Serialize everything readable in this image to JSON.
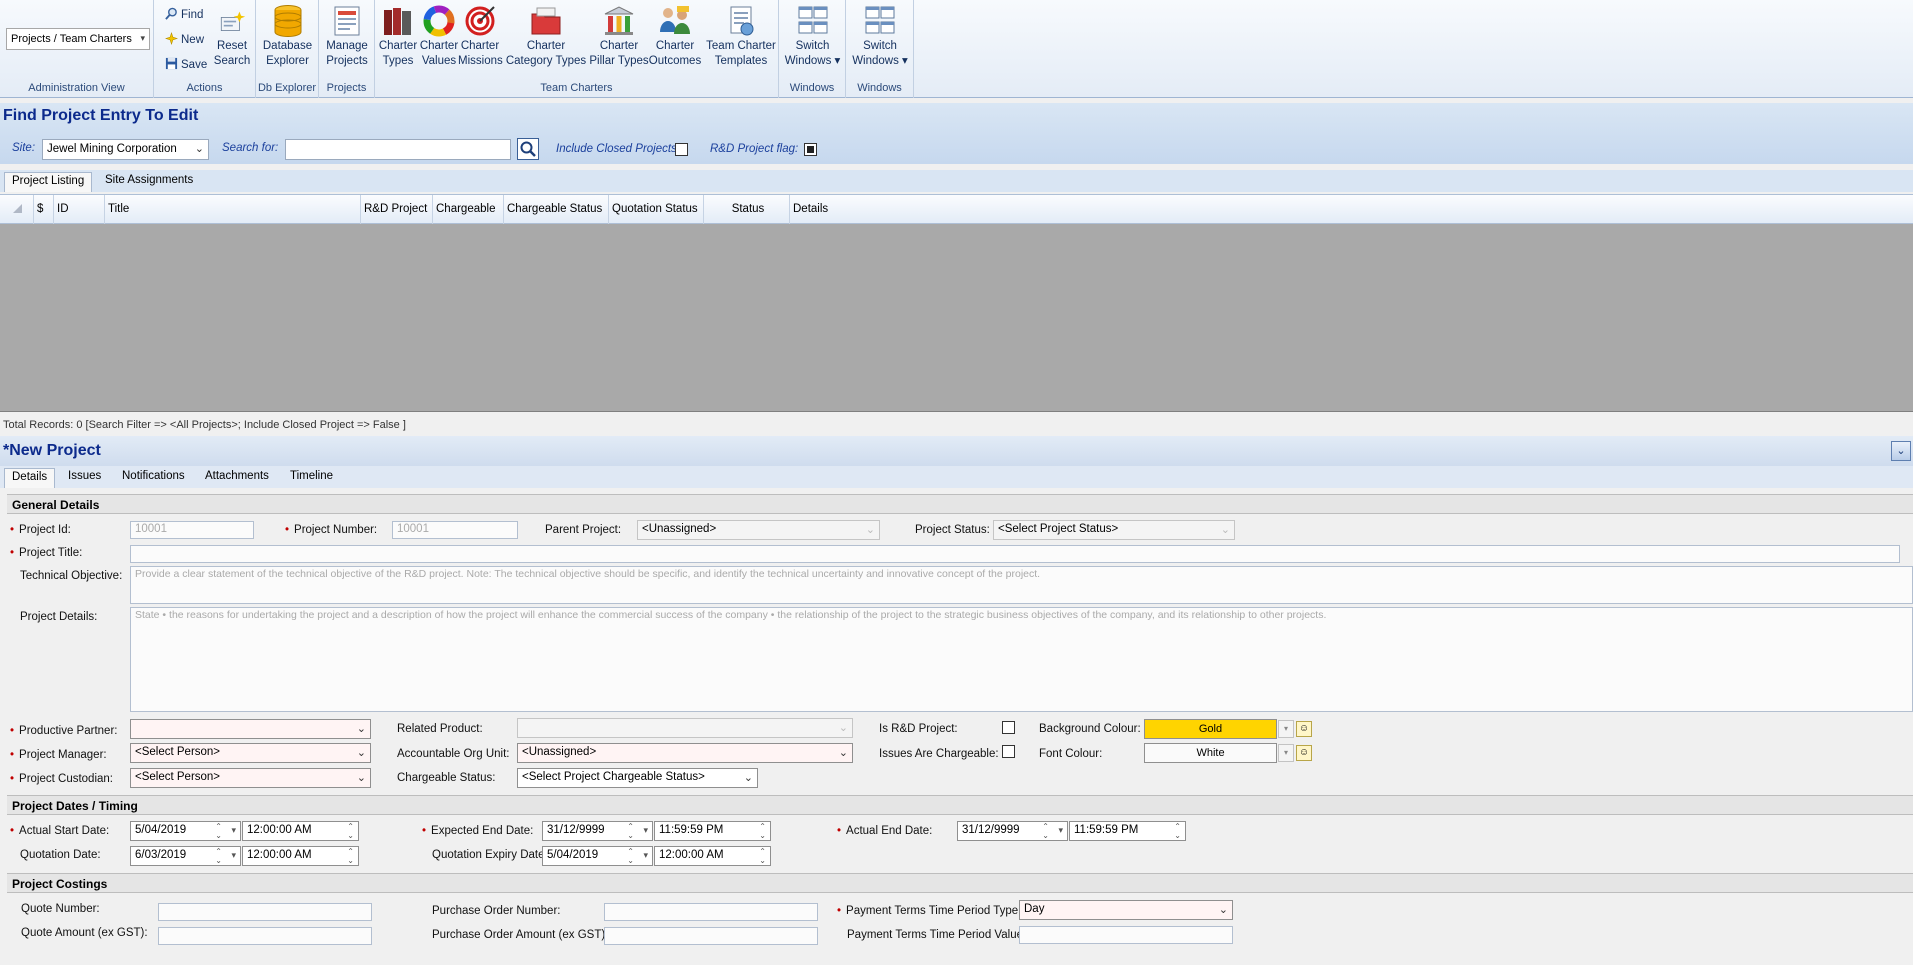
{
  "ribbon": {
    "view_selector": "Projects / Team Charters",
    "groups": {
      "admin": "Administration View",
      "actions": "Actions",
      "db": "Db Explorer",
      "projects": "Projects",
      "team_charters": "Team Charters",
      "windows1": "Windows",
      "windows2": "Windows"
    },
    "actions": {
      "find": "Find",
      "new": "New",
      "save": "Save",
      "reset_l1": "Reset",
      "reset_l2": "Search"
    },
    "db_explorer": {
      "l1": "Database",
      "l2": "Explorer"
    },
    "manage_projects": {
      "l1": "Manage",
      "l2": "Projects"
    },
    "charter_buttons": [
      {
        "l1": "Charter",
        "l2": "Types"
      },
      {
        "l1": "Charter",
        "l2": "Values"
      },
      {
        "l1": "Charter",
        "l2": "Missions"
      },
      {
        "l1": "Charter",
        "l2": "Category Types"
      },
      {
        "l1": "Charter",
        "l2": "Pillar Types"
      },
      {
        "l1": "Charter",
        "l2": "Outcomes"
      },
      {
        "l1": "Team Charter",
        "l2": "Templates"
      }
    ],
    "switch1": {
      "l1": "Switch",
      "l2": "Windows ▾"
    },
    "switch2": {
      "l1": "Switch",
      "l2": "Windows ▾"
    }
  },
  "find": {
    "title": "Find Project Entry To Edit",
    "site_label": "Site:",
    "site_value": "Jewel Mining Corporation",
    "search_label": "Search for:",
    "search_value": "",
    "include_closed_label": "Include Closed Projects:",
    "rd_flag_label": "R&D Project flag:"
  },
  "list_tabs": [
    "Project Listing",
    "Site Assignments"
  ],
  "grid": {
    "columns": [
      "$",
      "ID",
      "Title",
      "R&D Project",
      "Chargeable",
      "Chargeable Status",
      "Quotation Status",
      "Status",
      "Details"
    ]
  },
  "status_text": "Total Records: 0 [Search Filter => <All Projects>; Include Closed Project => False ]",
  "project": {
    "title": "*New Project",
    "tabs": [
      "Details",
      "Issues",
      "Notifications",
      "Attachments",
      "Timeline"
    ],
    "sections": {
      "general": "General Details",
      "dates": "Project Dates / Timing",
      "costings": "Project Costings"
    },
    "general": {
      "project_id_label": "Project Id:",
      "project_id_value": "10001",
      "project_number_label": "Project Number:",
      "project_number_value": "10001",
      "parent_project_label": "Parent Project:",
      "parent_project_value": "<Unassigned>",
      "project_status_label": "Project Status:",
      "project_status_value": "<Select Project Status>",
      "project_title_label": "Project Title:",
      "project_title_value": "",
      "tech_objective_label": "Technical Objective:",
      "tech_objective_placeholder": "Provide a clear statement of the technical objective of the R&D project.  Note:  The technical objective should be specific, and identify the technical uncertainty and innovative concept of the project.",
      "project_details_label": "Project Details:",
      "project_details_placeholder": "State    • the reasons for undertaking the project and a description of how the project will enhance the commercial success of the company   •  the relationship of the project to the strategic business objectives of the company, and its relationship to other projects.",
      "productive_partner_label": "Productive Partner:",
      "productive_partner_value": "",
      "project_manager_label": "Project Manager:",
      "project_manager_value": "<Select Person>",
      "project_custodian_label": "Project Custodian:",
      "project_custodian_value": "<Select Person>",
      "related_product_label": "Related Product:",
      "related_product_value": "",
      "accountable_org_label": "Accountable Org Unit:",
      "accountable_org_value": "<Unassigned>",
      "chargeable_status_label": "Chargeable Status:",
      "chargeable_status_value": "<Select Project Chargeable Status>",
      "is_rd_label": "Is R&D Project:",
      "issues_chargeable_label": "Issues Are Chargeable:",
      "bg_colour_label": "Background Colour:",
      "bg_colour_value": "Gold",
      "font_colour_label": "Font Colour:",
      "font_colour_value": "White"
    },
    "dates": {
      "actual_start_label": "Actual Start Date:",
      "actual_start_date": "5/04/2019",
      "actual_start_time": "12:00:00 AM",
      "quotation_label": "Quotation Date:",
      "quotation_date": "6/03/2019",
      "quotation_time": "12:00:00 AM",
      "expected_end_label": "Expected End Date:",
      "expected_end_date": "31/12/9999",
      "expected_end_time": "11:59:59 PM",
      "quotation_expiry_label": "Quotation Expiry Date:",
      "quotation_expiry_date": "5/04/2019",
      "quotation_expiry_time": "12:00:00 AM",
      "actual_end_label": "Actual End Date:",
      "actual_end_date": "31/12/9999",
      "actual_end_time": "11:59:59 PM"
    },
    "costings": {
      "quote_number_label": "Quote Number:",
      "quote_amount_label": "Quote Amount (ex GST):",
      "po_number_label": "Purchase Order Number:",
      "po_amount_label": "Purchase Order Amount (ex GST):",
      "payment_type_label": "Payment Terms Time Period Type:",
      "payment_type_value": "Day",
      "payment_value_label": "Payment Terms Time Period Value:"
    }
  },
  "colors": {
    "gold": "#ffd400",
    "accent": "#0c2a8c",
    "grid_empty": "#a9a9a9"
  }
}
